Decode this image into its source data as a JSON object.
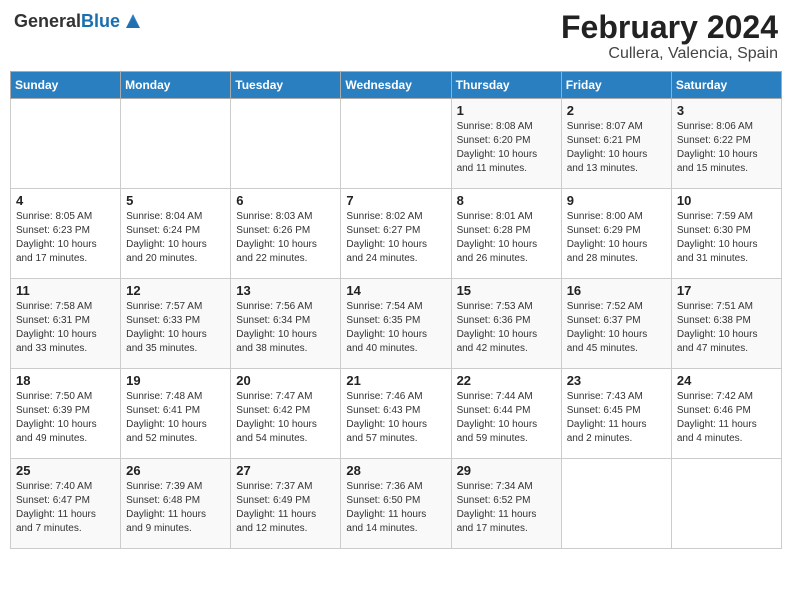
{
  "header": {
    "logo_general": "General",
    "logo_blue": "Blue",
    "title_month": "February 2024",
    "title_location": "Cullera, Valencia, Spain"
  },
  "calendar": {
    "days_of_week": [
      "Sunday",
      "Monday",
      "Tuesday",
      "Wednesday",
      "Thursday",
      "Friday",
      "Saturday"
    ],
    "weeks": [
      [
        {
          "day": "",
          "info": ""
        },
        {
          "day": "",
          "info": ""
        },
        {
          "day": "",
          "info": ""
        },
        {
          "day": "",
          "info": ""
        },
        {
          "day": "1",
          "info": "Sunrise: 8:08 AM\nSunset: 6:20 PM\nDaylight: 10 hours\nand 11 minutes."
        },
        {
          "day": "2",
          "info": "Sunrise: 8:07 AM\nSunset: 6:21 PM\nDaylight: 10 hours\nand 13 minutes."
        },
        {
          "day": "3",
          "info": "Sunrise: 8:06 AM\nSunset: 6:22 PM\nDaylight: 10 hours\nand 15 minutes."
        }
      ],
      [
        {
          "day": "4",
          "info": "Sunrise: 8:05 AM\nSunset: 6:23 PM\nDaylight: 10 hours\nand 17 minutes."
        },
        {
          "day": "5",
          "info": "Sunrise: 8:04 AM\nSunset: 6:24 PM\nDaylight: 10 hours\nand 20 minutes."
        },
        {
          "day": "6",
          "info": "Sunrise: 8:03 AM\nSunset: 6:26 PM\nDaylight: 10 hours\nand 22 minutes."
        },
        {
          "day": "7",
          "info": "Sunrise: 8:02 AM\nSunset: 6:27 PM\nDaylight: 10 hours\nand 24 minutes."
        },
        {
          "day": "8",
          "info": "Sunrise: 8:01 AM\nSunset: 6:28 PM\nDaylight: 10 hours\nand 26 minutes."
        },
        {
          "day": "9",
          "info": "Sunrise: 8:00 AM\nSunset: 6:29 PM\nDaylight: 10 hours\nand 28 minutes."
        },
        {
          "day": "10",
          "info": "Sunrise: 7:59 AM\nSunset: 6:30 PM\nDaylight: 10 hours\nand 31 minutes."
        }
      ],
      [
        {
          "day": "11",
          "info": "Sunrise: 7:58 AM\nSunset: 6:31 PM\nDaylight: 10 hours\nand 33 minutes."
        },
        {
          "day": "12",
          "info": "Sunrise: 7:57 AM\nSunset: 6:33 PM\nDaylight: 10 hours\nand 35 minutes."
        },
        {
          "day": "13",
          "info": "Sunrise: 7:56 AM\nSunset: 6:34 PM\nDaylight: 10 hours\nand 38 minutes."
        },
        {
          "day": "14",
          "info": "Sunrise: 7:54 AM\nSunset: 6:35 PM\nDaylight: 10 hours\nand 40 minutes."
        },
        {
          "day": "15",
          "info": "Sunrise: 7:53 AM\nSunset: 6:36 PM\nDaylight: 10 hours\nand 42 minutes."
        },
        {
          "day": "16",
          "info": "Sunrise: 7:52 AM\nSunset: 6:37 PM\nDaylight: 10 hours\nand 45 minutes."
        },
        {
          "day": "17",
          "info": "Sunrise: 7:51 AM\nSunset: 6:38 PM\nDaylight: 10 hours\nand 47 minutes."
        }
      ],
      [
        {
          "day": "18",
          "info": "Sunrise: 7:50 AM\nSunset: 6:39 PM\nDaylight: 10 hours\nand 49 minutes."
        },
        {
          "day": "19",
          "info": "Sunrise: 7:48 AM\nSunset: 6:41 PM\nDaylight: 10 hours\nand 52 minutes."
        },
        {
          "day": "20",
          "info": "Sunrise: 7:47 AM\nSunset: 6:42 PM\nDaylight: 10 hours\nand 54 minutes."
        },
        {
          "day": "21",
          "info": "Sunrise: 7:46 AM\nSunset: 6:43 PM\nDaylight: 10 hours\nand 57 minutes."
        },
        {
          "day": "22",
          "info": "Sunrise: 7:44 AM\nSunset: 6:44 PM\nDaylight: 10 hours\nand 59 minutes."
        },
        {
          "day": "23",
          "info": "Sunrise: 7:43 AM\nSunset: 6:45 PM\nDaylight: 11 hours\nand 2 minutes."
        },
        {
          "day": "24",
          "info": "Sunrise: 7:42 AM\nSunset: 6:46 PM\nDaylight: 11 hours\nand 4 minutes."
        }
      ],
      [
        {
          "day": "25",
          "info": "Sunrise: 7:40 AM\nSunset: 6:47 PM\nDaylight: 11 hours\nand 7 minutes."
        },
        {
          "day": "26",
          "info": "Sunrise: 7:39 AM\nSunset: 6:48 PM\nDaylight: 11 hours\nand 9 minutes."
        },
        {
          "day": "27",
          "info": "Sunrise: 7:37 AM\nSunset: 6:49 PM\nDaylight: 11 hours\nand 12 minutes."
        },
        {
          "day": "28",
          "info": "Sunrise: 7:36 AM\nSunset: 6:50 PM\nDaylight: 11 hours\nand 14 minutes."
        },
        {
          "day": "29",
          "info": "Sunrise: 7:34 AM\nSunset: 6:52 PM\nDaylight: 11 hours\nand 17 minutes."
        },
        {
          "day": "",
          "info": ""
        },
        {
          "day": "",
          "info": ""
        }
      ]
    ]
  }
}
